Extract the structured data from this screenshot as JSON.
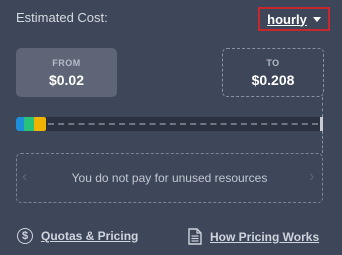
{
  "header": {
    "title": "Estimated Cost:",
    "period_selected": "hourly"
  },
  "from": {
    "label": "FROM",
    "value": "$0.02"
  },
  "to": {
    "label": "TO",
    "value": "$0.208"
  },
  "usage_bar": {
    "segment_colors": [
      "#1d8fd8",
      "#28c27a",
      "#f0b400"
    ],
    "track_color": "#2b313f"
  },
  "panel": {
    "text": "You do not pay for unused resources"
  },
  "footer": {
    "quotas_label": "Quotas & Pricing",
    "pricing_label": "How Pricing Works"
  },
  "icons": {
    "dollar": "dollar-icon",
    "document": "document-icon",
    "caret": "chevron-down-icon"
  },
  "colors": {
    "background": "#3e4659",
    "highlight_border": "#c8272d"
  }
}
